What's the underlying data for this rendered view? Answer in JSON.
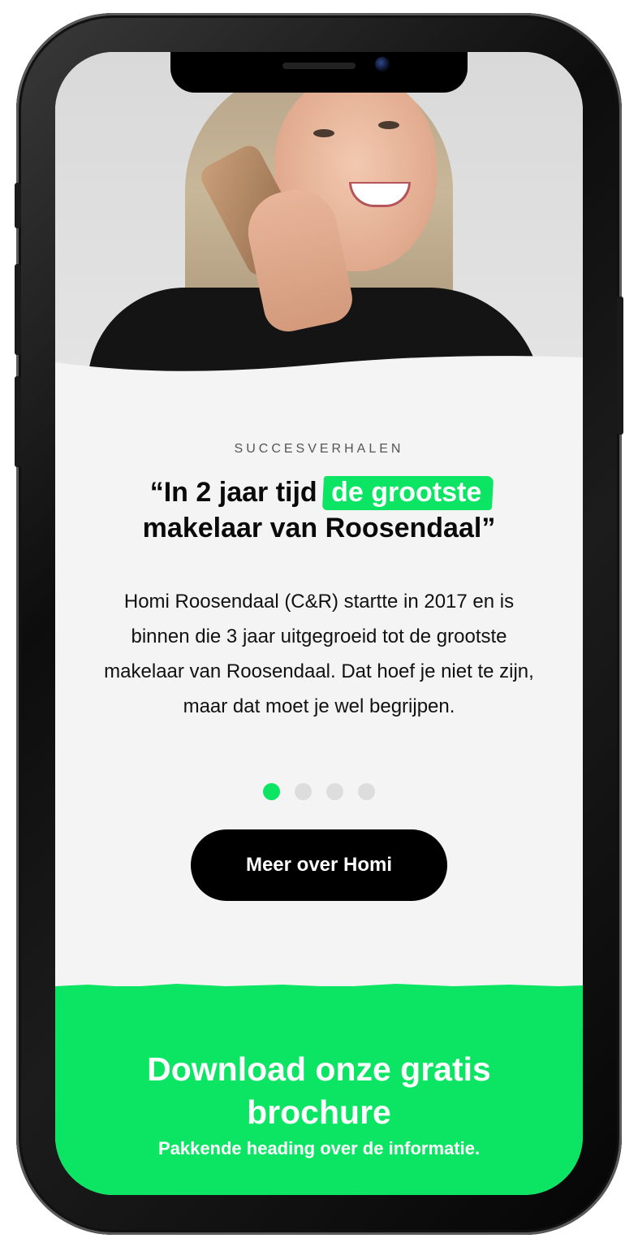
{
  "colors": {
    "accent": "#0be563",
    "button_bg": "#000000",
    "page_bg": "#f4f4f4",
    "dot_inactive": "#dddddd"
  },
  "section": {
    "eyebrow": "SUCCESVERHALEN",
    "headline_before": "“In 2 jaar tijd",
    "headline_highlight": "de grootste",
    "headline_after": "makelaar van Roosendaal”",
    "body": "Homi Roosendaal (C&R) startte in 2017 en is binnen die 3 jaar uitgegroeid tot de grootste makelaar van Roosendaal. Dat hoef je niet te zijn, maar dat moet je wel begrijpen."
  },
  "carousel": {
    "total_slides": 4,
    "active_index": 0
  },
  "cta": {
    "label": "Meer over Homi"
  },
  "download": {
    "title": "Download onze gratis brochure",
    "subtitle": "Pakkende heading over de informatie."
  },
  "hero_image": {
    "description_icon": "photo-woman-on-phone"
  }
}
